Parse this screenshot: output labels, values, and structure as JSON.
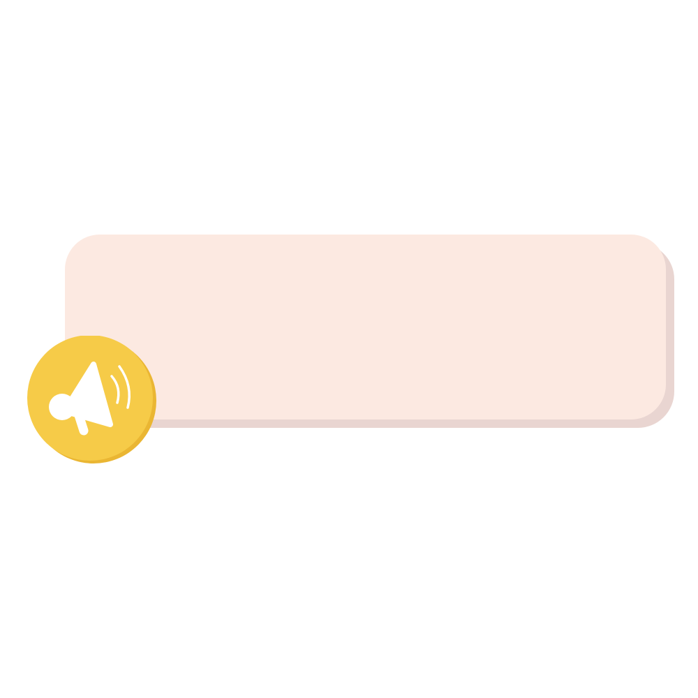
{
  "banner": {
    "text": "",
    "fill_color": "#fce9e1",
    "shadow_color": "#e9d5d1"
  },
  "badge": {
    "icon": "megaphone-icon",
    "color": "#f6cb48",
    "shade_color": "#eab633",
    "icon_color": "#ffffff"
  }
}
